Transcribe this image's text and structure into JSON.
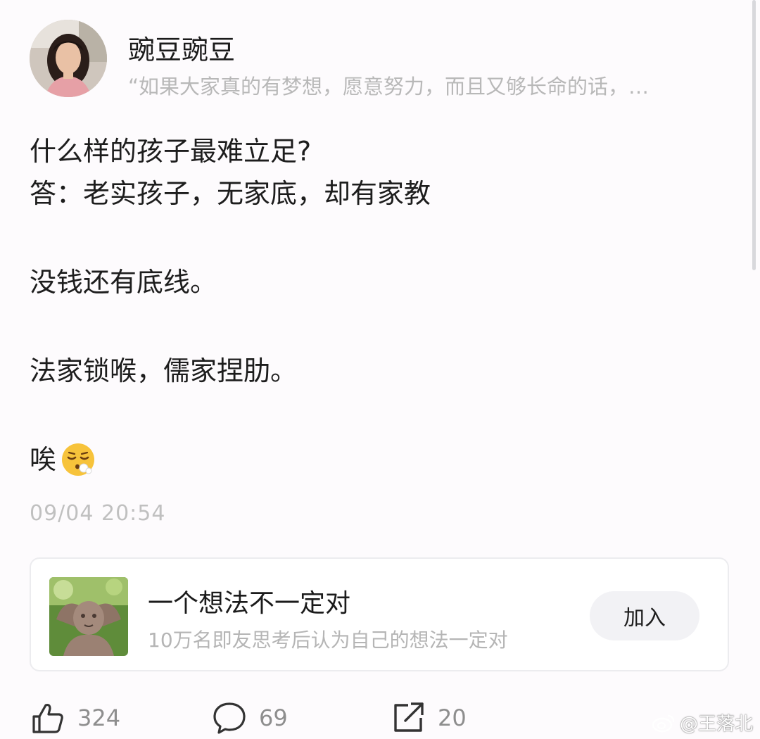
{
  "author": {
    "name": "豌豆豌豆",
    "signature": "“如果大家真的有梦想，愿意努力，而且又够长命的话，…"
  },
  "post": {
    "line1": "什么样的孩子最难立足?",
    "line2": "答：老实孩子，无家底，却有家教",
    "line3": "没钱还有底线。",
    "line4": "法家锁喉，儒家捏肋。",
    "line5": "唉",
    "emoji": "sigh-face-icon",
    "timestamp": "09/04 20:54"
  },
  "circle": {
    "title": "一个想法不一定对",
    "description": "10万名即友思考后认为自己的想法一定对",
    "join_label": "加入"
  },
  "actions": {
    "like_count": "324",
    "comment_count": "69",
    "share_count": "20"
  },
  "watermark": {
    "text": "@王落北",
    "icon": "weibo-icon"
  },
  "colors": {
    "background": "#fdfbfd",
    "secondary_text": "#b8b8b8",
    "button_bg": "#f2f2f5"
  }
}
